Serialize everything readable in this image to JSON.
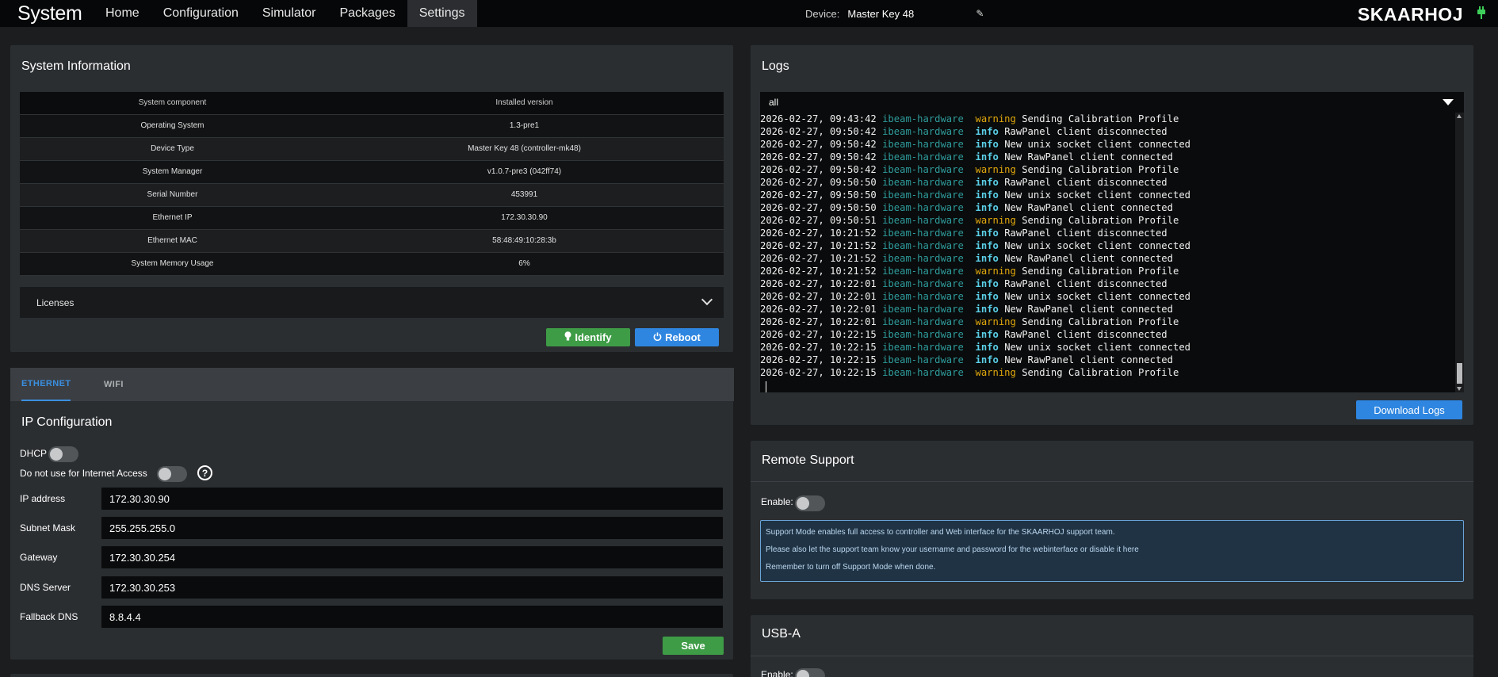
{
  "nav": {
    "brand": "System",
    "items": [
      "Home",
      "Configuration",
      "Simulator",
      "Packages",
      "Settings"
    ],
    "active": "Settings",
    "device_label": "Device:",
    "device_name": "Master Key 48",
    "logo": "SKAARHOJ"
  },
  "system_info": {
    "title": "System Information",
    "headers": [
      "System component",
      "Installed version"
    ],
    "rows": [
      [
        "Operating System",
        "1.3-pre1"
      ],
      [
        "Device Type",
        "Master Key 48 (controller-mk48)"
      ],
      [
        "System Manager",
        "v1.0.7-pre3 (042ff74)"
      ],
      [
        "Serial Number",
        "453991"
      ],
      [
        "Ethernet IP",
        "172.30.30.90"
      ],
      [
        "Ethernet MAC",
        "58:48:49:10:28:3b"
      ],
      [
        "System Memory Usage",
        "6%"
      ]
    ],
    "licenses_label": "Licenses",
    "identify_label": "Identify",
    "reboot_label": "Reboot"
  },
  "network": {
    "tabs": [
      "ETHERNET",
      "WIFI"
    ],
    "active_tab": "ETHERNET",
    "title": "IP Configuration",
    "dhcp_label": "DHCP",
    "internet_label": "Do not use for Internet Access",
    "fields": [
      {
        "label": "IP address",
        "value": "172.30.30.90"
      },
      {
        "label": "Subnet Mask",
        "value": "255.255.255.0"
      },
      {
        "label": "Gateway",
        "value": "172.30.30.254"
      },
      {
        "label": "DNS Server",
        "value": "172.30.30.253"
      },
      {
        "label": "Fallback DNS",
        "value": "8.8.4.4"
      }
    ],
    "save_label": "Save"
  },
  "logs": {
    "title": "Logs",
    "filter": "all",
    "download_label": "Download Logs",
    "lines": [
      [
        "2026-02-27, 09:43:42",
        "ibeam-hardware",
        "warning",
        "Sending Calibration Profile"
      ],
      [
        "2026-02-27, 09:50:42",
        "ibeam-hardware",
        "info",
        "RawPanel client disconnected"
      ],
      [
        "2026-02-27, 09:50:42",
        "ibeam-hardware",
        "info",
        "New unix socket client connected"
      ],
      [
        "2026-02-27, 09:50:42",
        "ibeam-hardware",
        "info",
        "New RawPanel client connected"
      ],
      [
        "2026-02-27, 09:50:42",
        "ibeam-hardware",
        "warning",
        "Sending Calibration Profile"
      ],
      [
        "2026-02-27, 09:50:50",
        "ibeam-hardware",
        "info",
        "RawPanel client disconnected"
      ],
      [
        "2026-02-27, 09:50:50",
        "ibeam-hardware",
        "info",
        "New unix socket client connected"
      ],
      [
        "2026-02-27, 09:50:50",
        "ibeam-hardware",
        "info",
        "New RawPanel client connected"
      ],
      [
        "2026-02-27, 09:50:51",
        "ibeam-hardware",
        "warning",
        "Sending Calibration Profile"
      ],
      [
        "2026-02-27, 10:21:52",
        "ibeam-hardware",
        "info",
        "RawPanel client disconnected"
      ],
      [
        "2026-02-27, 10:21:52",
        "ibeam-hardware",
        "info",
        "New unix socket client connected"
      ],
      [
        "2026-02-27, 10:21:52",
        "ibeam-hardware",
        "info",
        "New RawPanel client connected"
      ],
      [
        "2026-02-27, 10:21:52",
        "ibeam-hardware",
        "warning",
        "Sending Calibration Profile"
      ],
      [
        "2026-02-27, 10:22:01",
        "ibeam-hardware",
        "info",
        "RawPanel client disconnected"
      ],
      [
        "2026-02-27, 10:22:01",
        "ibeam-hardware",
        "info",
        "New unix socket client connected"
      ],
      [
        "2026-02-27, 10:22:01",
        "ibeam-hardware",
        "info",
        "New RawPanel client connected"
      ],
      [
        "2026-02-27, 10:22:01",
        "ibeam-hardware",
        "warning",
        "Sending Calibration Profile"
      ],
      [
        "2026-02-27, 10:22:15",
        "ibeam-hardware",
        "info",
        "RawPanel client disconnected"
      ],
      [
        "2026-02-27, 10:22:15",
        "ibeam-hardware",
        "info",
        "New unix socket client connected"
      ],
      [
        "2026-02-27, 10:22:15",
        "ibeam-hardware",
        "info",
        "New RawPanel client connected"
      ],
      [
        "2026-02-27, 10:22:15",
        "ibeam-hardware",
        "warning",
        "Sending Calibration Profile"
      ]
    ]
  },
  "remote_support": {
    "title": "Remote Support",
    "enable_label": "Enable:",
    "info_lines": [
      "Support Mode enables full access to controller and Web interface for the SKAARHOJ support team.",
      "Please also let the support team know your username and password for the webinterface or disable it here",
      "Remember to turn off Support Mode when done."
    ]
  },
  "usb": {
    "title": "USB-A",
    "enable_label": "Enable:"
  },
  "colors": {
    "accent": "#2f86e0",
    "success": "#3e9c46",
    "warning": "#e0a80c",
    "info": "#5ad0e8"
  }
}
